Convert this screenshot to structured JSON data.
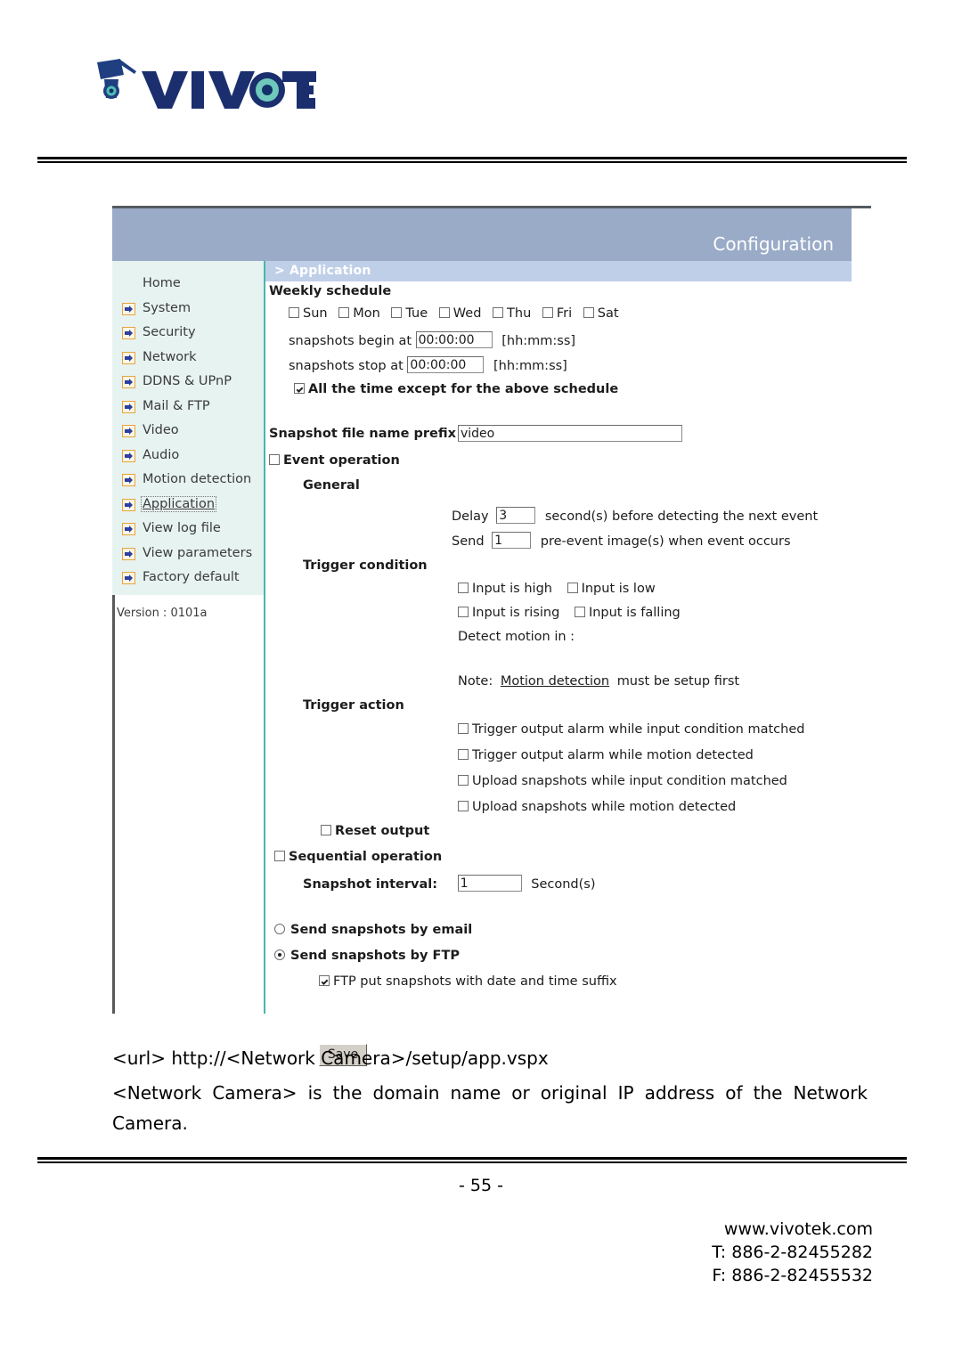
{
  "brand": {
    "logo_text": "VIVOTEK"
  },
  "panel": {
    "header_title": "Configuration",
    "breadcrumb": "> Application"
  },
  "sidebar": {
    "items": [
      {
        "label": "Home",
        "icon": null,
        "selected": false
      },
      {
        "label": "System",
        "icon": "arrow-icon",
        "selected": false
      },
      {
        "label": "Security",
        "icon": "arrow-icon",
        "selected": false
      },
      {
        "label": "Network",
        "icon": "arrow-icon",
        "selected": false
      },
      {
        "label": "DDNS & UPnP",
        "icon": "arrow-icon",
        "selected": false
      },
      {
        "label": "Mail & FTP",
        "icon": "arrow-icon",
        "selected": false
      },
      {
        "label": "Video",
        "icon": "arrow-icon",
        "selected": false
      },
      {
        "label": "Audio",
        "icon": "arrow-icon",
        "selected": false
      },
      {
        "label": "Motion detection",
        "icon": "arrow-icon",
        "selected": false
      },
      {
        "label": "Application",
        "icon": "arrow-icon",
        "selected": true
      },
      {
        "label": "View log file",
        "icon": "arrow-icon",
        "selected": false
      },
      {
        "label": "View parameters",
        "icon": "arrow-icon",
        "selected": false
      },
      {
        "label": "Factory default",
        "icon": "arrow-icon",
        "selected": false
      }
    ],
    "version": "Version : 0101a"
  },
  "form": {
    "weekly_schedule_title": "Weekly schedule",
    "days": [
      {
        "label": "Sun",
        "checked": false
      },
      {
        "label": "Mon",
        "checked": false
      },
      {
        "label": "Tue",
        "checked": false
      },
      {
        "label": "Wed",
        "checked": false
      },
      {
        "label": "Thu",
        "checked": false
      },
      {
        "label": "Fri",
        "checked": false
      },
      {
        "label": "Sat",
        "checked": false
      }
    ],
    "begin_label": "snapshots begin at",
    "begin_value": "00:00:00",
    "begin_hint": "[hh:mm:ss]",
    "stop_label": "snapshots stop at",
    "stop_value": "00:00:00",
    "stop_hint": "[hh:mm:ss]",
    "all_time_label": "All the time except for the above schedule",
    "all_time_checked": true,
    "prefix_label": "Snapshot file name prefix",
    "prefix_value": "video",
    "event_operation_label": "Event operation",
    "event_operation_checked": false,
    "general_label": "General",
    "delay_prefix": "Delay",
    "delay_value": "3",
    "delay_suffix": "second(s) before detecting the next event",
    "send_prefix": "Send",
    "send_value": "1",
    "send_suffix": "pre-event image(s) when event occurs",
    "trigger_condition_label": "Trigger condition",
    "conditions": [
      {
        "label": "Input is high",
        "checked": false
      },
      {
        "label": "Input is low",
        "checked": false
      },
      {
        "label": "Input is rising",
        "checked": false
      },
      {
        "label": "Input is falling",
        "checked": false
      }
    ],
    "detect_motion_label": "Detect motion in :",
    "note_prefix": "Note:",
    "note_link": "Motion detection",
    "note_suffix": "must be setup first",
    "trigger_action_label": "Trigger action",
    "actions": [
      {
        "label": "Trigger output alarm while input condition matched",
        "checked": false
      },
      {
        "label": "Trigger output alarm while motion detected",
        "checked": false
      },
      {
        "label": "Upload snapshots while input condition matched",
        "checked": false
      },
      {
        "label": "Upload snapshots while motion detected",
        "checked": false
      }
    ],
    "reset_output_label": "Reset output",
    "reset_output_checked": false,
    "sequential_operation_label": "Sequential operation",
    "sequential_operation_checked": false,
    "snapshot_interval_label": "Snapshot interval:",
    "snapshot_interval_value": "1",
    "snapshot_interval_suffix": "Second(s)",
    "send_email_label": "Send snapshots by email",
    "send_email_selected": false,
    "send_ftp_label": "Send snapshots by FTP",
    "send_ftp_selected": true,
    "ftp_suffix_label": "FTP put snapshots with date and time suffix",
    "ftp_suffix_checked": true,
    "save_label": "Save"
  },
  "body_text": {
    "url_line": "<url> http://<Network Camera>/setup/app.vspx",
    "description": "<Network Camera> is the domain name or original IP address of the Network Camera."
  },
  "footer": {
    "page_number": "- 55 -",
    "website": "www.vivotek.com",
    "tel": "T: 886-2-82455282",
    "fax": "F: 886-2-82455532"
  },
  "colors": {
    "header_blue": "#9aabc8",
    "breadcrumb_blue": "#c0cfe8",
    "sidebar_mint": "#e7f3f1",
    "divider_teal": "#49b5ae",
    "icon_orange": "#e8a33d"
  }
}
